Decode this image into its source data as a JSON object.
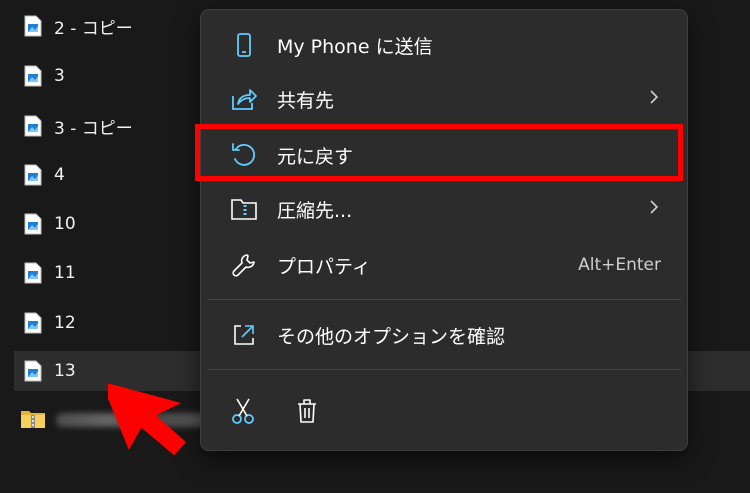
{
  "files": [
    {
      "name": "2 - コピー"
    },
    {
      "name": "3"
    },
    {
      "name": "3 - コピー"
    },
    {
      "name": "4"
    },
    {
      "name": "10"
    },
    {
      "name": "11"
    },
    {
      "name": "12"
    },
    {
      "name": "13"
    }
  ],
  "menu": {
    "send_to_phone": "My Phone に送信",
    "share": "共有先",
    "restore": "元に戻す",
    "compress": "圧縮先...",
    "properties": "プロパティ",
    "properties_shortcut": "Alt+Enter",
    "more_options": "その他のオプションを確認"
  },
  "colors": {
    "accent": "#60cdff",
    "highlight": "#ff0000",
    "menu_bg": "#2c2c2c",
    "page_bg": "#191919"
  },
  "icons": [
    "phone-icon",
    "share-icon",
    "undo-icon",
    "zip-folder-icon",
    "wrench-icon",
    "open-external-icon",
    "cut-icon",
    "trash-icon",
    "chevron-right-icon",
    "image-file-icon",
    "zip-folder-icon"
  ]
}
